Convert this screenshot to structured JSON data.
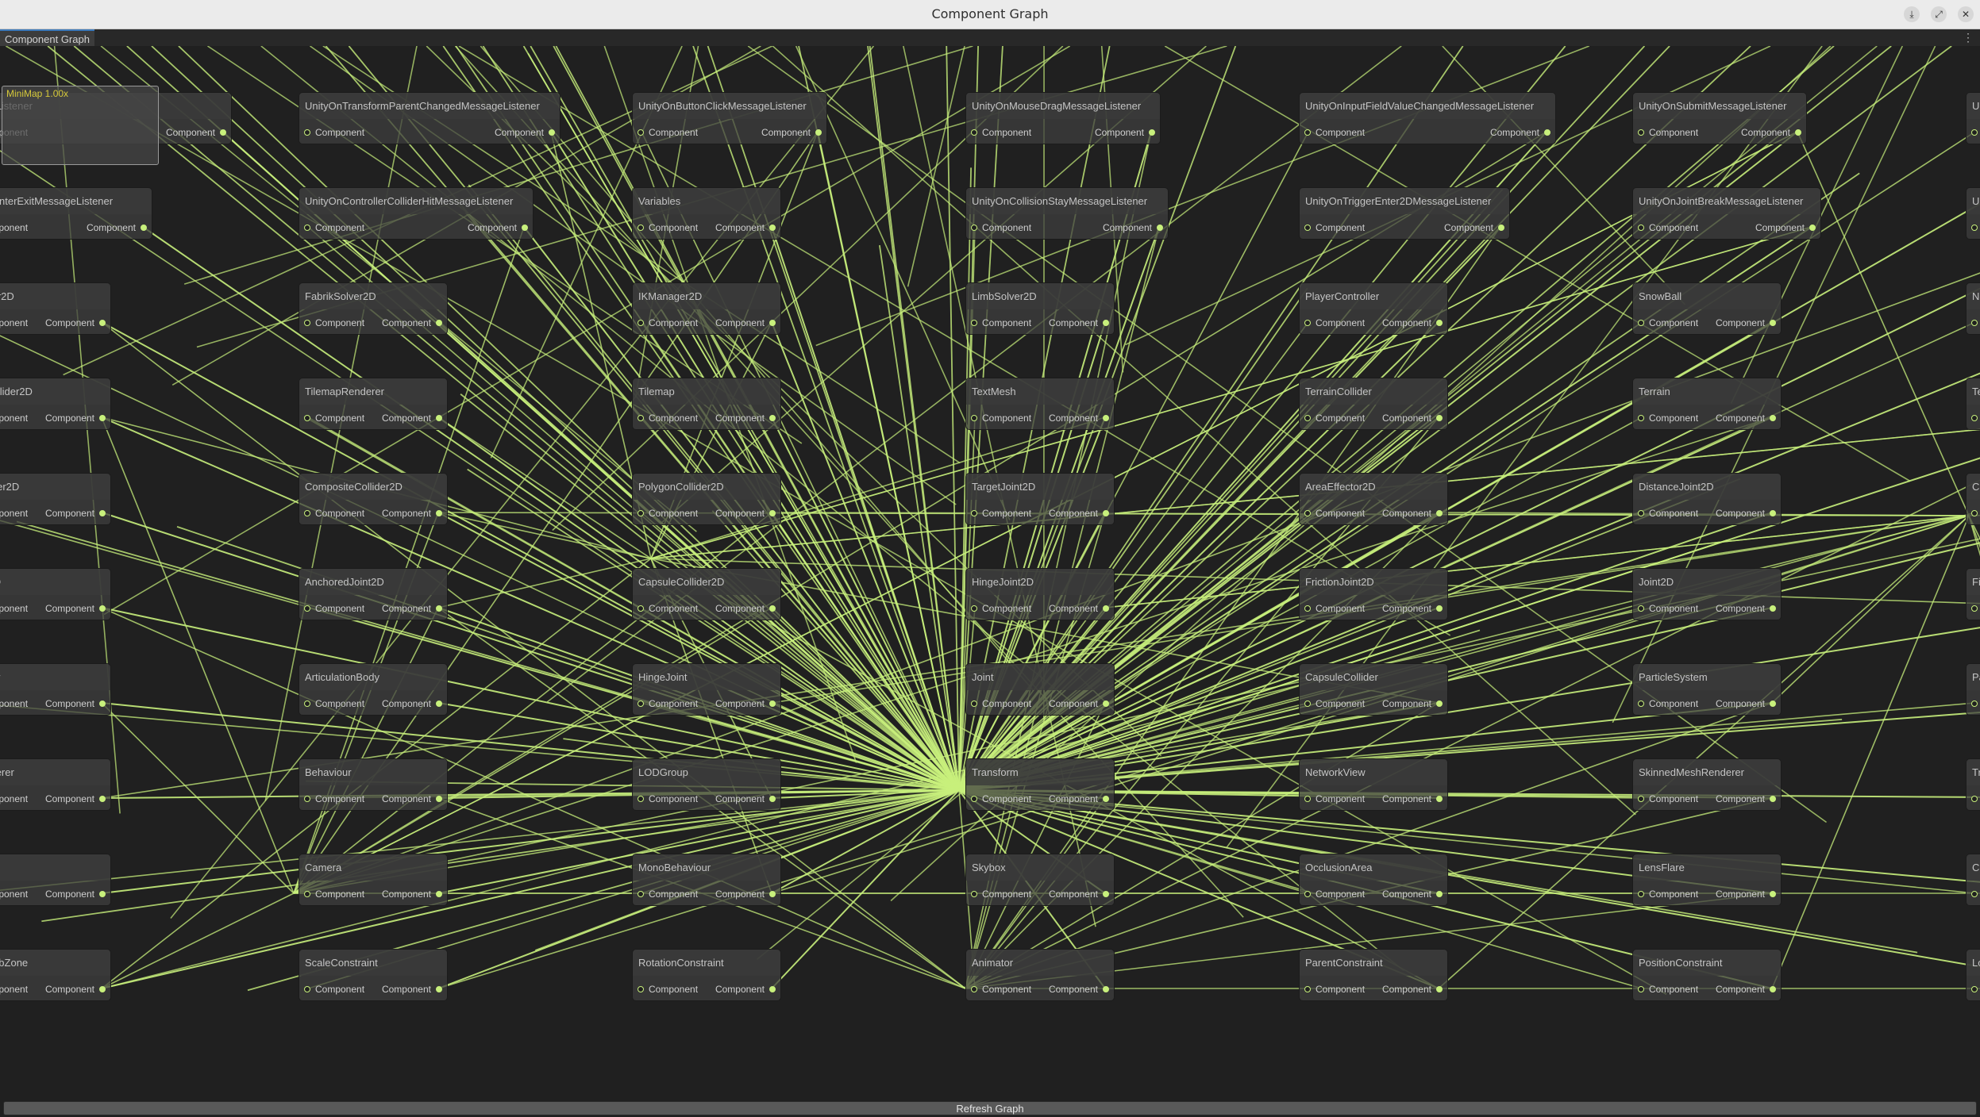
{
  "window": {
    "title": "Component Graph",
    "buttons": [
      "download-icon",
      "maximize-icon",
      "close-icon"
    ]
  },
  "tab": {
    "label": "Component Graph"
  },
  "minimap": {
    "label": "MiniMap  1.00x"
  },
  "port_labels": {
    "input": "Component",
    "output": "Component"
  },
  "edge_color": "#c8f07c",
  "hub_node": "Transform",
  "nodes": [
    "…ageListener",
    "UnityOnTransformParentChangedMessageListener",
    "UnityOnButtonClickMessageListener",
    "UnityOnMouseDragMessageListener",
    "UnityOnInputFieldValueChangedMessageListener",
    "UnityOnSubmitMessageListener",
    "Ur…",
    "…nPointerExitMessageListener",
    "UnityOnControllerColliderHitMessageListener",
    "Variables",
    "UnityOnCollisionStayMessageListener",
    "UnityOnTriggerEnter2DMessageListener",
    "UnityOnJointBreakMessageListener",
    "Ur…",
    "…olver2D",
    "FabrikSolver2D",
    "IKManager2D",
    "LimbSolver2D",
    "PlayerController",
    "SnowBall",
    "Ne…",
    "…pCollider2D",
    "TilemapRenderer",
    "Tilemap",
    "TextMesh",
    "TerrainCollider",
    "Terrain",
    "Te…",
    "…ollider2D",
    "CompositeCollider2D",
    "PolygonCollider2D",
    "TargetJoint2D",
    "AreaEffector2D",
    "DistanceJoint2D",
    "Ci…",
    "…or2D",
    "AnchoredJoint2D",
    "CapsuleCollider2D",
    "HingeJoint2D",
    "FrictionJoint2D",
    "Joint2D",
    "Fi…",
    "…llider",
    "ArticulationBody",
    "HingeJoint",
    "Joint",
    "CapsuleCollider",
    "ParticleSystem",
    "Pa…",
    "…enderer",
    "Behaviour",
    "LODGroup",
    "Transform",
    "NetworkView",
    "SkinnedMeshRenderer",
    "Tr…",
    "",
    "Camera",
    "MonoBehaviour",
    "Skybox",
    "OcclusionArea",
    "LensFlare",
    "Cl…",
    "…everbZone",
    "ScaleConstraint",
    "RotationConstraint",
    "Animator",
    "ParentConstraint",
    "PositionConstraint",
    "Lo…"
  ],
  "footer": {
    "refresh_label": "Refresh Graph"
  }
}
